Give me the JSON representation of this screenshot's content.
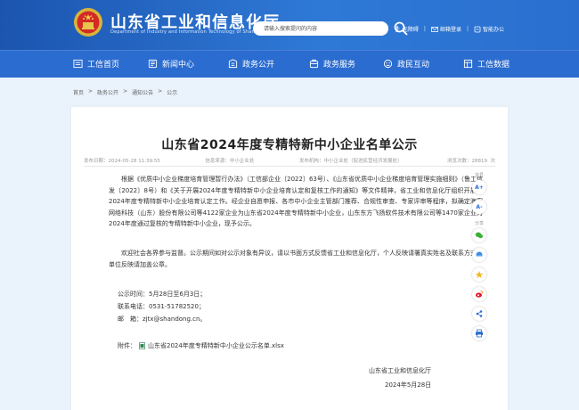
{
  "header": {
    "title": "山东省工业和信息化厅",
    "subtitle": "Department of Industry and Information Technology of Shandong Province",
    "search_placeholder": "请输入搜索提问的内容",
    "links": [
      {
        "label": "无障碍",
        "icon": "accessibility-icon"
      },
      {
        "label": "邮箱登录",
        "icon": "mail-icon"
      },
      {
        "label": "智能办公",
        "icon": "office-icon"
      }
    ]
  },
  "nav": {
    "items": [
      {
        "label": "工信首页",
        "icon": "home-icon"
      },
      {
        "label": "新闻中心",
        "icon": "news-icon"
      },
      {
        "label": "政务公开",
        "icon": "gov-open-icon"
      },
      {
        "label": "政务服务",
        "icon": "service-icon"
      },
      {
        "label": "政民互动",
        "icon": "interaction-icon"
      },
      {
        "label": "工信数据",
        "icon": "data-icon"
      }
    ]
  },
  "breadcrumb": [
    "首页",
    ">",
    "政务公开",
    ">",
    "通知公告",
    ">",
    "公示"
  ],
  "article": {
    "title": "山东省2024年度专精特新中小企业名单公示",
    "meta": {
      "date": "发布日期：2024-05-28 11:39:55",
      "source": "信息来源：中小企业处",
      "org": "发布机构：中小企业处（促进民营经济发展处）",
      "views": "浏览次数：28819",
      "views_unit": "次"
    },
    "p1": "根据《优质中小企业梯度培育管理暂行办法》（工信部企业〔2022〕63号）、《山东省优质中小企业梯度培育管理实施细则》（鲁工信发〔2022〕8号）和《关于开展2024年度专精特新中小企业培育认定和复核工作的通知》等文件精神，省工业和信息化厅组织开展了2024年度专精特新中小企业培育认定工作。经企业自愿申报、各市中小企业主管部门推荐、合规性审查、专家评审等程序，拟确定海客网络科技（山东）股份有限公司等4122家企业为山东省2024年度专精特新中小企业，山东东方飞扬软件技术有限公司等1470家企业为2024年度通过复核的专精特新中小企业，现予公示。",
    "p2": "欢迎社会各界参与监督。公示期间如对公示对象有异议，请以书面方式反馈省工业和信息化厅，个人反映请署真实姓名及联系方式，单位反映请加盖公章。",
    "contact": {
      "period": "公示时间：5月28日至6月3日；",
      "phone": "联系电话：0531-51782520；",
      "email": "邮　箱：zjtx@shandong.cn。"
    },
    "attachment_label": "附件：",
    "attachment_file": "山东省2024年度专精特新中小企业公示名单.xlsx",
    "sign_org": "山东省工业和信息化厅",
    "sign_date": "2024年5月28日"
  },
  "tools": {
    "font_label": "字号",
    "font_increase": "A+",
    "font_decrease": "A-",
    "share_label": "分享"
  },
  "colors": {
    "header_blue": "#1b55b0",
    "nav_blue": "#2b6cd0",
    "page_bg": "#eaf2fb"
  }
}
